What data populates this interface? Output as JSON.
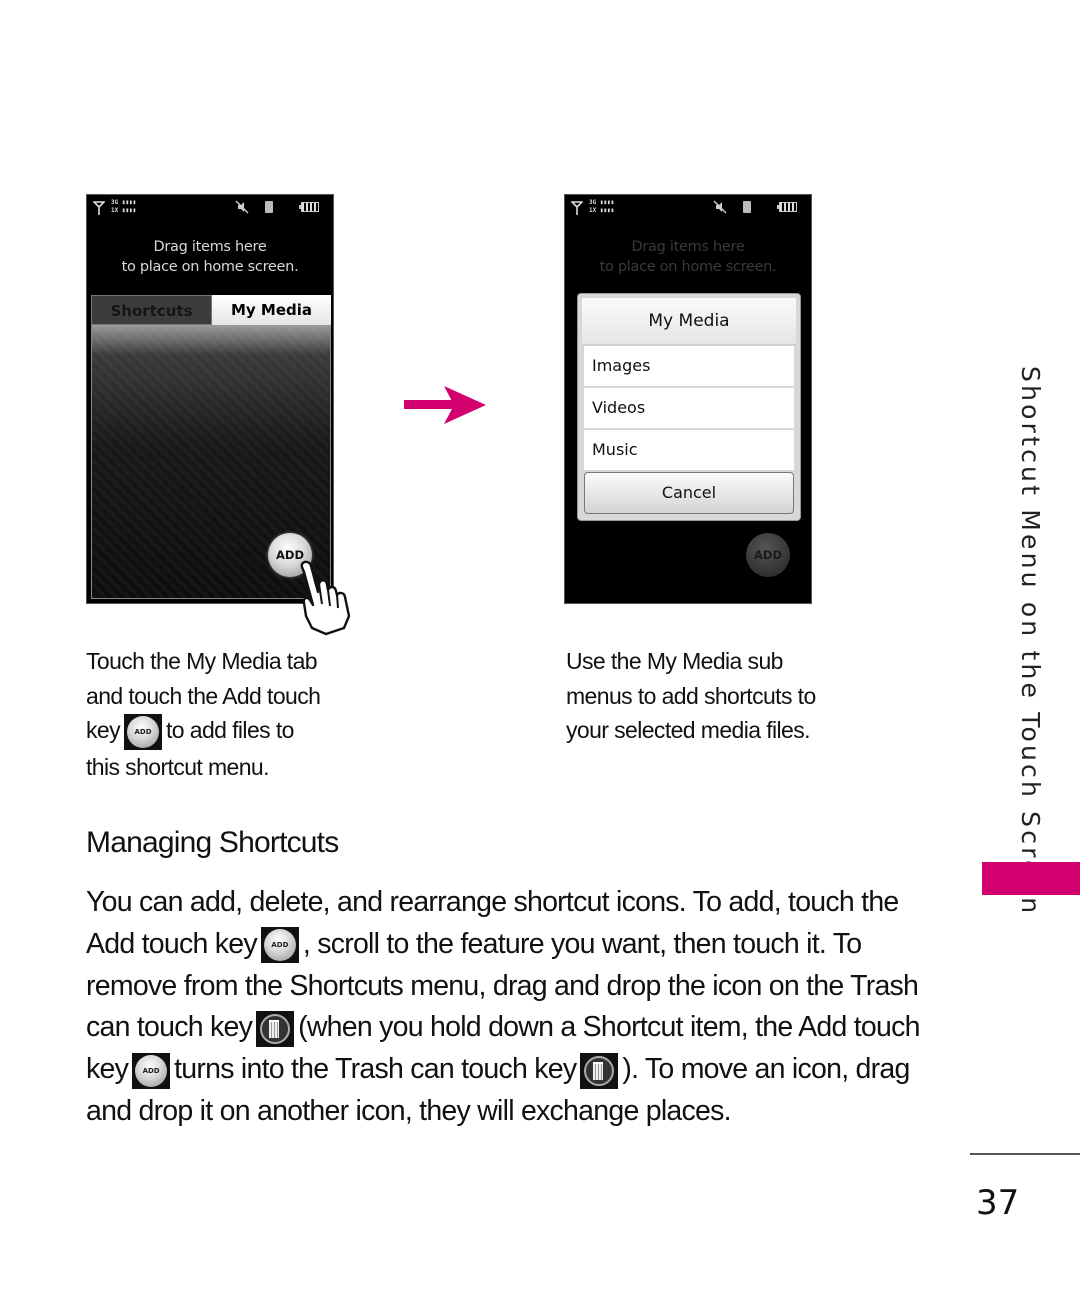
{
  "colors": {
    "accent": "#d1006e"
  },
  "phone_left": {
    "status": {
      "network_top": "3G ▮▮▮▮",
      "network_bottom": "1X ▮▮▮▮"
    },
    "drag_hint_line1": "Drag items here",
    "drag_hint_line2": "to place on home screen.",
    "tabs": [
      {
        "label": "Shortcuts",
        "active": false
      },
      {
        "label": "My Media",
        "active": true
      }
    ],
    "add_button_label": "ADD"
  },
  "phone_right": {
    "status": {
      "network_top": "3G ▮▮▮▮",
      "network_bottom": "1X ▮▮▮▮"
    },
    "drag_hint_line1": "Drag items here",
    "drag_hint_line2": "to place on home screen.",
    "dialog": {
      "title": "My Media",
      "items": [
        "Images",
        "Videos",
        "Music"
      ],
      "cancel_label": "Cancel"
    },
    "add_button_label": "ADD"
  },
  "captions": {
    "left": {
      "line1": "Touch the My Media tab",
      "line2": "and touch the Add touch",
      "line3_pre": "key",
      "line3_post": "to add files to",
      "line4": "this shortcut menu."
    },
    "right": {
      "line1": "Use the My Media sub",
      "line2": "menus to add shortcuts to",
      "line3": "your selected media files."
    }
  },
  "inline_add_key_label": "ADD",
  "section": {
    "title": "Managing Shortcuts",
    "body": {
      "p1": "You can add, delete, and rearrange shortcut icons.  To add, touch the Add touch key",
      "p2": ", scroll to the feature you want, then touch it. To remove from the Shortcuts menu, drag and drop the icon on the Trash can touch key",
      "p3": "(when you hold down a Shortcut item, the Add touch key",
      "p4": "turns into the Trash can touch key",
      "p5": "). To move an icon, drag and drop it on another icon, they will exchange places."
    }
  },
  "side_tab_title": "Shortcut Menu on the Touch Screen",
  "page_number": "37"
}
